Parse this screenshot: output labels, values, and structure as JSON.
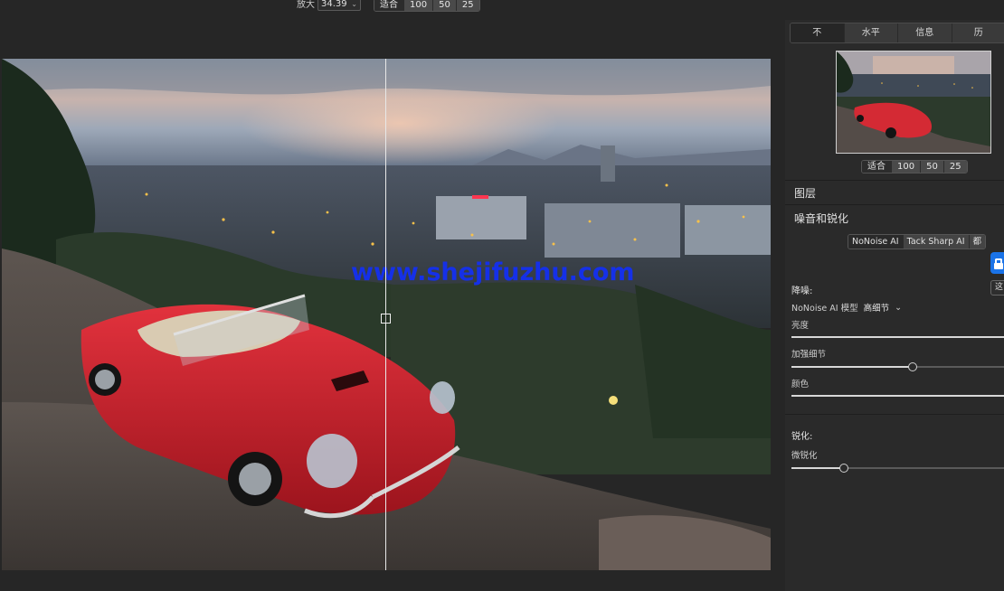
{
  "toolbar": {
    "zoom_label": "放大",
    "zoom_value": "34.39",
    "zoom_presets": [
      "适合",
      "100",
      "50",
      "25"
    ]
  },
  "canvas": {
    "watermark": "www.shejifuzhu.com"
  },
  "panel": {
    "tabs": [
      "不",
      "水平",
      "信息",
      "历"
    ],
    "nav_zoom_presets": [
      "适合",
      "100",
      "50",
      "25"
    ],
    "layers_title": "图层",
    "section_title": "噪音和锐化",
    "modes": [
      "NoNoise AI",
      "Tack Sharp AI",
      "都"
    ],
    "small_button_label": "这",
    "denoise": {
      "title": "降噪:",
      "model_label": "NoNoise AI 模型",
      "model_value": "高细节",
      "brightness_label": "亮度",
      "brightness_value": 1.0,
      "detail_label": "加强细节",
      "detail_value": 0.56,
      "color_label": "颜色",
      "color_value": 1.0
    },
    "sharpen": {
      "title": "锐化:",
      "micro_label": "微锐化",
      "micro_value": 0.24
    }
  }
}
